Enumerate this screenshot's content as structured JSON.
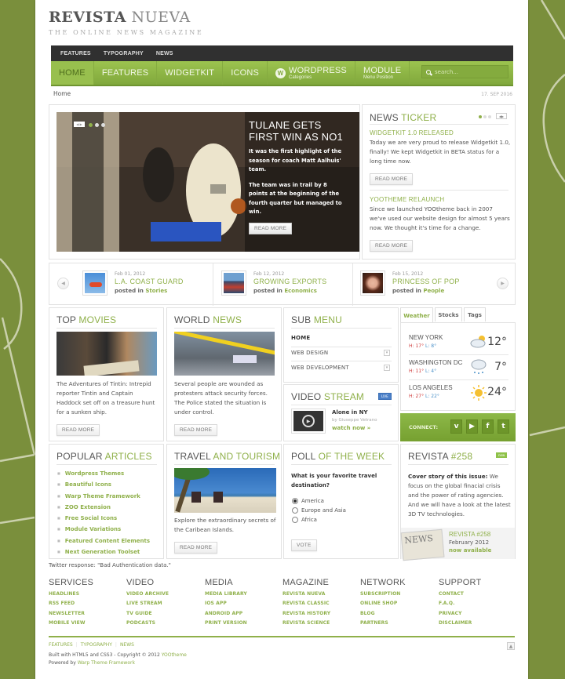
{
  "site": {
    "logo_bold": "REVISTA",
    "logo_light": "NUEVA",
    "tagline": "THE ONLINE NEWS MAGAZINE"
  },
  "topbar": [
    "FEATURES",
    "TYPOGRAPHY",
    "NEWS"
  ],
  "mainnav": {
    "items": [
      {
        "label": "HOME",
        "active": true
      },
      {
        "label": "FEATURES"
      },
      {
        "label": "WIDGETKIT"
      },
      {
        "label": "ICONS"
      },
      {
        "label": "WORDPRESS",
        "sub": "Categories",
        "icon": "wordpress-icon"
      },
      {
        "label": "MODULE",
        "sub": "Menu Position"
      }
    ],
    "search_placeholder": "search..."
  },
  "breadcrumb": "Home",
  "date": "17. SEP 2016",
  "slideshow": {
    "title": "TULANE GETS FIRST WIN AS NO1",
    "paragraphs": [
      "It was the first highlight of the season for coach Matt Aalhuis' team.",
      "The team was in trail by 8 points at the beginning of the fourth quarter but managed to win."
    ],
    "button": "READ MORE"
  },
  "ticker": {
    "title_a": "NEWS",
    "title_b": "TICKER",
    "items": [
      {
        "heading": "WIDGETKIT 1.0 RELEASED",
        "text": "Today we are very proud to release Widgetkit 1.0, finally! We kept Widgetkit in BETA status for a long time now.",
        "button": "READ MORE"
      },
      {
        "heading": "YOOTHEME RELAUNCH",
        "text": "Since we launched YOOtheme back in 2007 we've used our website design for almost 5 years now. We thought it's time for a change.",
        "button": "READ MORE"
      }
    ]
  },
  "carousel": [
    {
      "date": "Feb 01, 2012",
      "title": "L.A. COAST GUARD",
      "posted": "posted in",
      "category": "Stories"
    },
    {
      "date": "Feb 12, 2012",
      "title": "GROWING EXPORTS",
      "posted": "posted in",
      "category": "Economics"
    },
    {
      "date": "Feb 15, 2012",
      "title": "PRINCESS OF POP",
      "posted": "posted in",
      "category": "People"
    }
  ],
  "top_movies": {
    "title_a": "TOP",
    "title_b": "MOVIES",
    "text": "The Adventures of Tintin: Intrepid reporter Tintin and Captain Haddock set off on a treasure hunt for a sunken ship.",
    "button": "READ MORE"
  },
  "world_news": {
    "title_a": "WORLD",
    "title_b": "NEWS",
    "text": "Several people are wounded as protesters attack security forces. The Police stated the situation is under control.",
    "button": "READ MORE"
  },
  "sub_menu": {
    "title_a": "SUB",
    "title_b": "MENU",
    "items": [
      "HOME",
      "WEB DESIGN",
      "WEB DEVELOPMENT"
    ]
  },
  "video_stream": {
    "title_a": "VIDEO",
    "title_b": "STREAM",
    "badge": "LIVE",
    "video_title": "Alone in NY",
    "author": "by Giuseppe Vetrano",
    "link": "watch now »"
  },
  "weather": {
    "tabs": [
      "Weather",
      "Stocks",
      "Tags"
    ],
    "cities": [
      {
        "name": "NEW YORK",
        "high": "H: 17°",
        "low": "L: 8°",
        "temp": "12°",
        "icon": "partly-cloudy-icon"
      },
      {
        "name": "WASHINGTON DC",
        "high": "H: 11°",
        "low": "L: 4°",
        "temp": "7°",
        "icon": "rain-cloud-icon"
      },
      {
        "name": "LOS ANGELES",
        "high": "H: 27°",
        "low": "L: 22°",
        "temp": "24°",
        "icon": "sun-icon"
      }
    ]
  },
  "connect": {
    "label": "CONNECT:",
    "icons": [
      {
        "name": "vimeo-icon",
        "glyph": "v"
      },
      {
        "name": "youtube-icon",
        "glyph": "▶"
      },
      {
        "name": "facebook-icon",
        "glyph": "f"
      },
      {
        "name": "twitter-icon",
        "glyph": "t"
      }
    ]
  },
  "popular": {
    "title_a": "POPULAR",
    "title_b": "ARTICLES",
    "items": [
      "Wordpress Themes",
      "Beautiful Icons",
      "Warp Theme Framework",
      "ZOO Extension",
      "Free Social Icons",
      "Module Variations",
      "Featured Content Elements",
      "Next Generation Toolset"
    ]
  },
  "travel": {
    "title_a": "TRAVEL",
    "title_b": "AND TOURISM",
    "text": "Explore the extraordinary secrets of the Caribean Islands.",
    "button": "READ MORE"
  },
  "poll": {
    "title_a": "POLL",
    "title_b": "OF THE WEEK",
    "question": "What is your favorite travel destination?",
    "options": [
      "America",
      "Europe and Asia",
      "Africa"
    ],
    "selected": 0,
    "button": "VOTE"
  },
  "revista": {
    "title_a": "REVISTA",
    "title_b": "#258",
    "badge": "new",
    "lead": "Cover story of this issue:",
    "text": " We focus on the global finacial crisis and the power of rating agencies. And we will have a look at the latest 3D TV technologies.",
    "issue": "REVISTA #258",
    "month": "February 2012",
    "available": "now available"
  },
  "twitter_response": "Twitter response: \"Bad Authentication data.\"",
  "footer_columns": [
    {
      "title": "SERVICES",
      "links": [
        "HEADLINES",
        "RSS FEED",
        "NEWSLETTER",
        "MOBILE VIEW"
      ]
    },
    {
      "title": "VIDEO",
      "links": [
        "VIDEO ARCHIVE",
        "LIVE STREAM",
        "TV GUIDE",
        "PODCASTS"
      ]
    },
    {
      "title": "MEDIA",
      "links": [
        "MEDIA LIBRARY",
        "IOS APP",
        "ANDROID APP",
        "PRINT VERSION"
      ]
    },
    {
      "title": "MAGAZINE",
      "links": [
        "REVISTA NUEVA",
        "REVISTA CLASSIC",
        "REVISTA HISTORY",
        "REVISTA SCIENCE"
      ]
    },
    {
      "title": "NETWORK",
      "links": [
        "SUBSCRIPTION",
        "ONLINE SHOP",
        "BLOG",
        "PARTNERS"
      ]
    },
    {
      "title": "SUPPORT",
      "links": [
        "CONTACT",
        "F.A.Q.",
        "PRIVACY",
        "DISCLAIMER"
      ]
    }
  ],
  "footer": {
    "links": [
      "FEATURES",
      "TYPOGRAPHY",
      "NEWS"
    ],
    "built": "Built with HTML5 and CSS3 - Copyright © 2012",
    "built_link": "YOOtheme",
    "powered": "Powered by",
    "powered_link": "Warp Theme Framework"
  },
  "colors": {
    "accent": "#8fb04a",
    "nav_green": "#8cb444",
    "background": "#7a8f3c",
    "topbar": "#303030"
  }
}
